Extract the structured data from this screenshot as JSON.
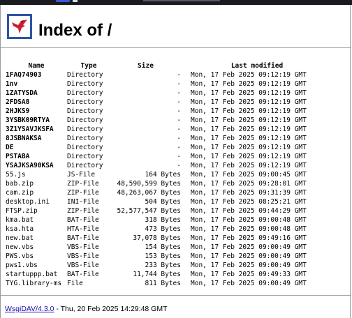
{
  "page": {
    "title": "Index of /",
    "columns": {
      "name": "Name",
      "type": "Type",
      "size": "Size",
      "modified": "Last modified"
    },
    "rows": [
      {
        "name": "1FAQ74903",
        "type": "Directory",
        "size": "-",
        "modified": "Mon, 17 Feb 2025 09:12:19 GMT",
        "dir": true
      },
      {
        "name": "1nv",
        "type": "Directory",
        "size": "-",
        "modified": "Mon, 17 Feb 2025 09:12:19 GMT",
        "dir": true
      },
      {
        "name": "1ZATYSDA",
        "type": "Directory",
        "size": "-",
        "modified": "Mon, 17 Feb 2025 09:12:19 GMT",
        "dir": true
      },
      {
        "name": "2FDSA8",
        "type": "Directory",
        "size": "-",
        "modified": "Mon, 17 Feb 2025 09:12:19 GMT",
        "dir": true
      },
      {
        "name": "2HJKS9",
        "type": "Directory",
        "size": "-",
        "modified": "Mon, 17 Feb 2025 09:12:19 GMT",
        "dir": true
      },
      {
        "name": "3YSBK09RTYA",
        "type": "Directory",
        "size": "-",
        "modified": "Mon, 17 Feb 2025 09:12:19 GMT",
        "dir": true
      },
      {
        "name": "3Z1YSAVJKSFA",
        "type": "Directory",
        "size": "-",
        "modified": "Mon, 17 Feb 2025 09:12:19 GMT",
        "dir": true
      },
      {
        "name": "8JSBNAKSA",
        "type": "Directory",
        "size": "-",
        "modified": "Mon, 17 Feb 2025 09:12:19 GMT",
        "dir": true
      },
      {
        "name": "DE",
        "type": "Directory",
        "size": "-",
        "modified": "Mon, 17 Feb 2025 09:12:19 GMT",
        "dir": true
      },
      {
        "name": "PSTABA",
        "type": "Directory",
        "size": "-",
        "modified": "Mon, 17 Feb 2025 09:12:19 GMT",
        "dir": true
      },
      {
        "name": "YSAJKSA90KSA",
        "type": "Directory",
        "size": "-",
        "modified": "Mon, 17 Feb 2025 09:12:19 GMT",
        "dir": true
      },
      {
        "name": "55.js",
        "type": "JS-File",
        "size": "164 Bytes",
        "modified": "Mon, 17 Feb 2025 09:00:45 GMT",
        "dir": false
      },
      {
        "name": "bab.zip",
        "type": "ZIP-File",
        "size": "48,590,599 Bytes",
        "modified": "Mon, 17 Feb 2025 09:28:01 GMT",
        "dir": false
      },
      {
        "name": "cam.zip",
        "type": "ZIP-File",
        "size": "48,263,067 Bytes",
        "modified": "Mon, 17 Feb 2025 09:31:39 GMT",
        "dir": false
      },
      {
        "name": "desktop.ini",
        "type": "INI-File",
        "size": "504 Bytes",
        "modified": "Mon, 17 Feb 2025 08:25:21 GMT",
        "dir": false
      },
      {
        "name": "FTSP.zip",
        "type": "ZIP-File",
        "size": "52,577,547 Bytes",
        "modified": "Mon, 17 Feb 2025 09:44:29 GMT",
        "dir": false
      },
      {
        "name": "kma.bat",
        "type": "BAT-File",
        "size": "318 Bytes",
        "modified": "Mon, 17 Feb 2025 09:00:48 GMT",
        "dir": false
      },
      {
        "name": "ksa.hta",
        "type": "HTA-File",
        "size": "473 Bytes",
        "modified": "Mon, 17 Feb 2025 09:00:48 GMT",
        "dir": false
      },
      {
        "name": "new.bat",
        "type": "BAT-File",
        "size": "37,078 Bytes",
        "modified": "Mon, 17 Feb 2025 09:49:16 GMT",
        "dir": false
      },
      {
        "name": "new.vbs",
        "type": "VBS-File",
        "size": "154 Bytes",
        "modified": "Mon, 17 Feb 2025 09:00:49 GMT",
        "dir": false
      },
      {
        "name": "PWS.vbs",
        "type": "VBS-File",
        "size": "153 Bytes",
        "modified": "Mon, 17 Feb 2025 09:00:49 GMT",
        "dir": false
      },
      {
        "name": "pws1.vbs",
        "type": "VBS-File",
        "size": "233 Bytes",
        "modified": "Mon, 17 Feb 2025 09:00:49 GMT",
        "dir": false
      },
      {
        "name": "startuppp.bat",
        "type": "BAT-File",
        "size": "11,744 Bytes",
        "modified": "Mon, 17 Feb 2025 09:49:33 GMT",
        "dir": false
      },
      {
        "name": "TYG.library-ms",
        "type": "File",
        "size": "811 Bytes",
        "modified": "Mon, 17 Feb 2025 09:00:49 GMT",
        "dir": false
      }
    ],
    "footer": {
      "link_label": "WsgiDAV/4.3.0",
      "text": " - Thu, 20 Feb 2025 14:29:48 GMT"
    }
  },
  "icons": {
    "logo": "wsgidav-bird-logo-icon"
  },
  "colors": {
    "logo_blue": "#2d55a3",
    "logo_red": "#c8232c",
    "link": "#1a0dab"
  }
}
